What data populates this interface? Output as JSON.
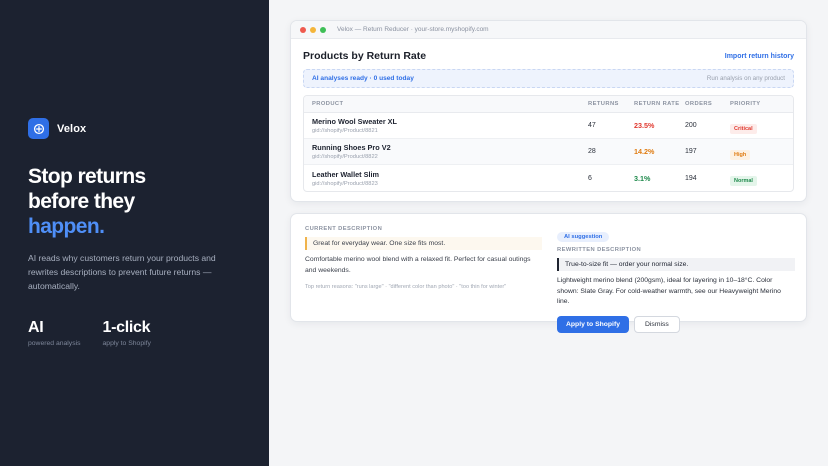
{
  "hero": {
    "brand_name": "Velox",
    "headline_line1": "Stop returns",
    "headline_line2": "before they",
    "headline_accent": "happen.",
    "description": "AI reads why customers return your products and rewrites descriptions to prevent future returns — automatically.",
    "stats": [
      {
        "value": "AI",
        "label": "powered analysis"
      },
      {
        "value": "1-click",
        "label": "apply to Shopify"
      }
    ]
  },
  "window": {
    "title": "Velox — Return Reducer · your-store.myshopify.com"
  },
  "products": {
    "title": "Products by Return Rate",
    "import_link": "Import return history",
    "banner_left": "AI analyses ready · 0 used today",
    "banner_right": "Run analysis on any product",
    "columns": [
      "PRODUCT",
      "RETURNS",
      "RETURN RATE",
      "ORDERS",
      "PRIORITY"
    ],
    "rows": [
      {
        "name": "Merino Wool Sweater XL",
        "gid": "gid://shopify/Product/8821",
        "returns": "47",
        "rate": "23.5%",
        "orders": "200",
        "priority": "Critical"
      },
      {
        "name": "Running Shoes Pro V2",
        "gid": "gid://shopify/Product/8822",
        "returns": "28",
        "rate": "14.2%",
        "orders": "197",
        "priority": "High"
      },
      {
        "name": "Leather Wallet Slim",
        "gid": "gid://shopify/Product/8823",
        "returns": "6",
        "rate": "3.1%",
        "orders": "194",
        "priority": "Normal"
      }
    ]
  },
  "colors": {
    "accent": "#2f6fe6",
    "critical": "#e0392f",
    "high": "#e07b10",
    "normal": "#1f8a4c"
  },
  "suggestion": {
    "current_label": "CURRENT DESCRIPTION",
    "current_quote": "Great for everyday wear. One size fits most.",
    "current_body": "Comfortable merino wool blend with a relaxed fit. Perfect for casual outings and weekends.",
    "reasons": "Top return reasons: \"runs large\" · \"different color than photo\" · \"too thin for winter\"",
    "ai_pill": "AI suggestion",
    "rewritten_label": "REWRITTEN DESCRIPTION",
    "new_quote": "True-to-size fit — order your normal size.",
    "new_body": "Lightweight merino blend (200gsm), ideal for layering in 10–18°C. Color shown: Slate Gray. For cold-weather warmth, see our Heavyweight Merino line.",
    "apply_button": "Apply to Shopify",
    "dismiss_button": "Dismiss"
  }
}
